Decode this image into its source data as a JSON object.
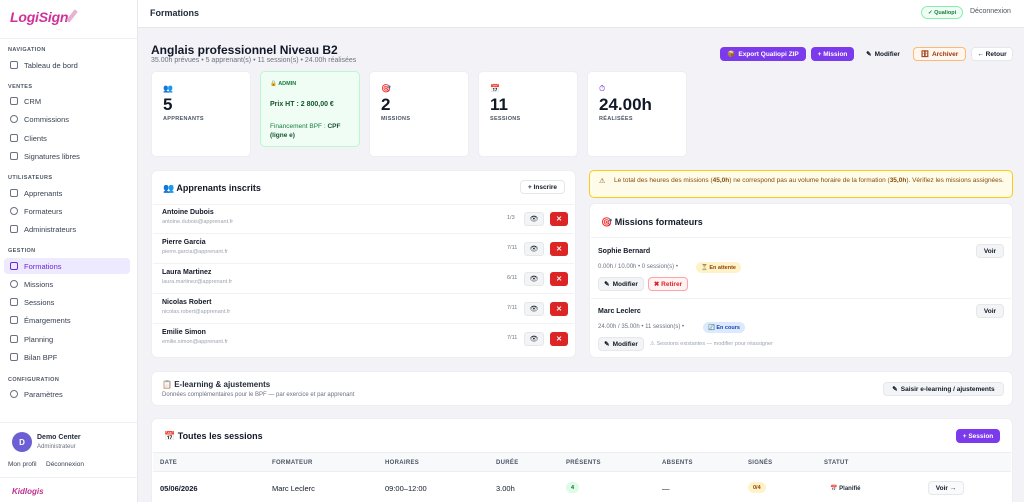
{
  "app": {
    "brand": "LogiSign",
    "brand_sub": "........",
    "footer_brand": "Kidlogis"
  },
  "topbar": {
    "title": "Formations",
    "qualiopi": "✓ Qualiopi",
    "logout": "Déconnexion"
  },
  "nav": {
    "sections": {
      "navigation": "NAVIGATION",
      "ventes": "VENTES",
      "utilisateurs": "UTILISATEURS",
      "gestion": "GESTION",
      "configuration": "CONFIGURATION"
    },
    "items": {
      "dashboard": "Tableau de bord",
      "crm": "CRM",
      "commissions": "Commissions",
      "clients": "Clients",
      "signatures": "Signatures libres",
      "apprenants": "Apprenants",
      "formateurs": "Formateurs",
      "administrateurs": "Administrateurs",
      "formations": "Formations",
      "missions": "Missions",
      "sessions": "Sessions",
      "emargements": "Émargements",
      "planning": "Planning",
      "bilan": "Bilan BPF",
      "parametres": "Paramètres"
    }
  },
  "user": {
    "initial": "D",
    "name": "Demo Center",
    "role": "Administrateur",
    "profile_link": "Mon profil",
    "logout_link": "Déconnexion"
  },
  "formation": {
    "title": "Anglais professionnel Niveau B2",
    "subtitle": "35.00h prévues • 5 apprenant(s) • 11 session(s) • 24.00h réalisées"
  },
  "actions": {
    "export": "Export Qualiopi ZIP",
    "mission": "+ Mission",
    "modifier": "Modifier",
    "archiver": "Archiver",
    "retour": "← Retour"
  },
  "stats": {
    "apprenants": {
      "value": "5",
      "label": "APPRENANTS"
    },
    "missions": {
      "value": "2",
      "label": "MISSIONS"
    },
    "sessions": {
      "value": "11",
      "label": "SESSIONS"
    },
    "realisees": {
      "value": "24.00h",
      "label": "RÉALISÉES"
    }
  },
  "admin_card": {
    "label": "ADMIN",
    "prix_label": "Prix HT : ",
    "prix": "2 800,00 €",
    "financement_label": "Financement BPF : ",
    "financement": "CPF (ligne e)"
  },
  "apprenants_card": {
    "title": "Apprenants inscrits",
    "inscrire": "+ Inscrire",
    "rows": [
      {
        "name": "Antoine Dubois",
        "email": "antoine.dubois@apprenant.fr",
        "ratio": "1/3"
      },
      {
        "name": "Pierre Garcia",
        "email": "pierre.garcia@apprenant.fr",
        "ratio": "7/11"
      },
      {
        "name": "Laura Martinez",
        "email": "laura.martinez@apprenant.fr",
        "ratio": "6/11"
      },
      {
        "name": "Nicolas Robert",
        "email": "nicolas.robert@apprenant.fr",
        "ratio": "7/11"
      },
      {
        "name": "Emilie Simon",
        "email": "emilie.simon@apprenant.fr",
        "ratio": "7/11"
      }
    ]
  },
  "warning": {
    "text_a": "Le total des heures des missions (",
    "missions_hours": "45,0h",
    "text_b": ") ne correspond pas au volume horaire de la formation (",
    "formation_hours": "35,0h",
    "text_c": "). Vérifiez les missions assignées."
  },
  "missions_card": {
    "title": "Missions formateurs",
    "voir": "Voir",
    "modifier": "Modifier",
    "retirer": "✖ Retirer",
    "sessions_note": "⚠ Sessions existantes — modifier pour réassigner",
    "rows": [
      {
        "name": "Sophie Bernard",
        "detail": "0.00h / 10.00h • 0 session(s) •",
        "status": "⏳ En attente"
      },
      {
        "name": "Marc Leclerc",
        "detail": "24.00h / 35.00h • 11 session(s) •",
        "status": "🔄 En cours"
      }
    ]
  },
  "elearning": {
    "title": "E-learning & ajustements",
    "subtitle": "Données complémentaires pour le BPF — par exercice et par apprenant",
    "button": "Saisir e-learning / ajustements"
  },
  "sessions_card": {
    "title": "Toutes les sessions",
    "add": "+ Session",
    "headers": [
      "DATE",
      "FORMATEUR",
      "HORAIRES",
      "DURÉE",
      "PRÉSENTS",
      "ABSENTS",
      "SIGNÉS",
      "STATUT"
    ],
    "rows": [
      {
        "date": "05/06/2026",
        "formateur": "Marc Leclerc",
        "horaires": "09:00–12:00",
        "duree": "3.00h",
        "presents": "4",
        "absents": "—",
        "signes": "0/4",
        "statut": "Planifié",
        "voir": "Voir →"
      }
    ]
  },
  "colors": {
    "accent": "#7c3aed",
    "danger": "#dc2626",
    "success": "#16a34a"
  }
}
